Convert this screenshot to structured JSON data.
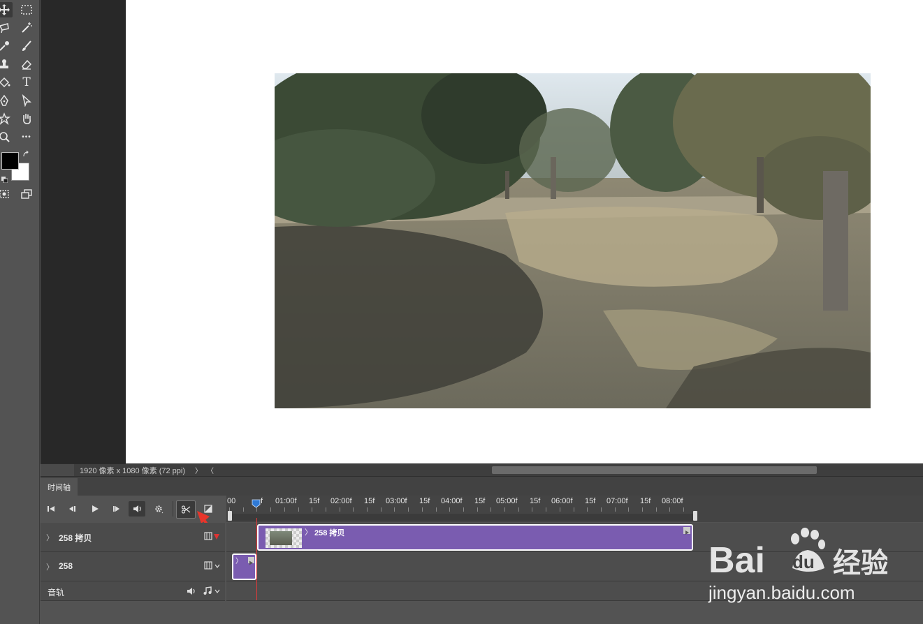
{
  "toolbar": {
    "tools": [
      {
        "name": "move-icon"
      },
      {
        "name": "marquee-icon"
      },
      {
        "name": "lasso-icon"
      },
      {
        "name": "magic-wand-icon"
      },
      {
        "name": "eyedropper-icon"
      },
      {
        "name": "brush-icon"
      },
      {
        "name": "stamp-icon"
      },
      {
        "name": "eraser-icon"
      },
      {
        "name": "paint-bucket-icon"
      },
      {
        "name": "type-icon",
        "glyph": "T"
      },
      {
        "name": "pen-icon"
      },
      {
        "name": "path-select-icon"
      },
      {
        "name": "custom-shape-icon"
      },
      {
        "name": "hand-icon"
      },
      {
        "name": "zoom-icon"
      },
      {
        "name": "more-tools-icon",
        "glyph": "•••"
      }
    ],
    "foreground_color": "#000000",
    "background_color": "#ffffff"
  },
  "status": {
    "doc_info": "1920 像素 x 1080 像素 (72 ppi)",
    "arrow_right": "〉",
    "arrow_left": "〈"
  },
  "timeline": {
    "tab_label": "时间轴",
    "ruler": {
      "labels": [
        "00",
        "f",
        "01:00f",
        "15f",
        "02:00f",
        "15f",
        "03:00f",
        "15f",
        "04:00f",
        "15f",
        "05:00f",
        "15f",
        "06:00f",
        "15f",
        "07:00f",
        "15f",
        "08:00f"
      ]
    },
    "tracks": [
      {
        "label": "258 拷贝",
        "clip_label": "258 拷贝"
      },
      {
        "label": "258"
      }
    ],
    "audio_label": "音轨"
  },
  "colors": {
    "clip_purple": "#7a5cb0",
    "playhead": "#e03a3a"
  },
  "watermark": {
    "brand": "Bai du 经验",
    "url": "jingyan.baidu.com"
  }
}
